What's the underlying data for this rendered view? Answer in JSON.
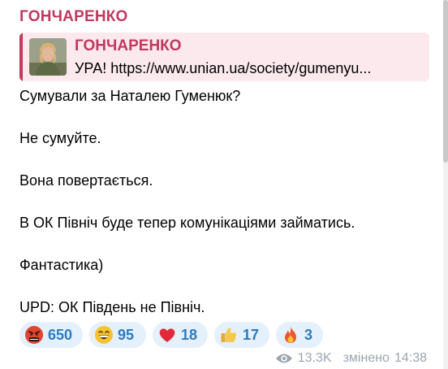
{
  "channel": {
    "name": "ГОНЧАРЕНКО"
  },
  "reply": {
    "author": "ГОНЧАРЕНКО",
    "text": "УРА!   https://www.unian.ua/society/gumenyu..."
  },
  "message": {
    "lines": [
      "Сумували за Наталею Гуменюк?",
      "Не сумуйте.",
      "Вона повертається.",
      "В ОК Північ буде тепер комунікаціями займатись.",
      "Фантастика)",
      "UPD: ОК Південь не Північ."
    ]
  },
  "reactions": [
    {
      "icon": "angry-face-icon",
      "count": "650"
    },
    {
      "icon": "grinning-face-icon",
      "count": "95"
    },
    {
      "icon": "red-heart-icon",
      "count": "18"
    },
    {
      "icon": "thumbs-up-icon",
      "count": "17"
    },
    {
      "icon": "fire-icon",
      "count": "3"
    }
  ],
  "meta": {
    "views": "13.3K",
    "status": "змінено",
    "time": "14:38"
  },
  "colors": {
    "accent": "#c0395f",
    "reply_bg": "#fbe9ee",
    "reaction_bg": "#e4f0fb",
    "reaction_text": "#2a7bc0",
    "meta_text": "#9aa6b0"
  }
}
